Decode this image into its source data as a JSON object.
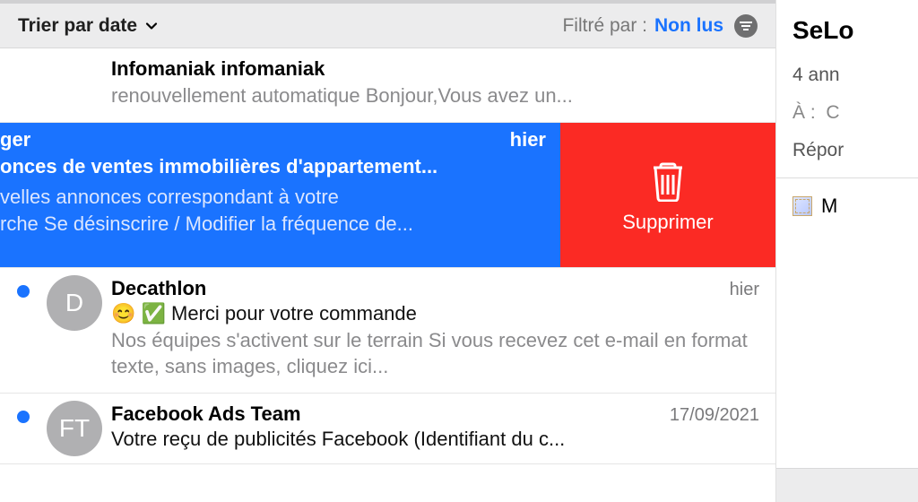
{
  "toolbar": {
    "sort_label": "Trier par date",
    "filter_prefix": "Filtré par :",
    "filter_value": "Non lus"
  },
  "rows": [
    {
      "sender": "Infomaniak   infomaniak",
      "subject": "",
      "preview": "renouvellement automatique Bonjour,Vous avez un...",
      "date": ""
    },
    {
      "sender_suffix": "ger",
      "date": "hier",
      "subject": "onces de ventes immobilières d'appartement...",
      "preview_line1": "velles annonces correspondant à votre",
      "preview_line2": "rche Se désinscrire / Modifier la fréquence de...",
      "delete_label": "Supprimer"
    },
    {
      "avatar": "D",
      "sender": "Decathlon",
      "date": "hier",
      "subject": "😊 ✅ Merci pour votre commande",
      "preview": "Nos équipes s'activent sur le terrain Si vous recevez cet e-mail en format texte, sans images, cliquez ici..."
    },
    {
      "avatar": "FT",
      "sender": "Facebook Ads Team",
      "date": "17/09/2021",
      "subject": "Votre reçu de publicités Facebook (Identifiant du c...",
      "preview": ""
    }
  ],
  "preview_pane": {
    "sender": "SeLo",
    "time": "4 ann",
    "to_label": "À :",
    "to_value": "C",
    "reply_label": "Répor",
    "attachment_label": "M"
  }
}
